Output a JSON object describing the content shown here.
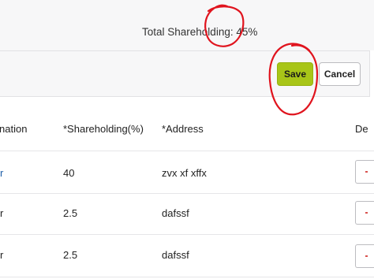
{
  "summary": {
    "total_text": "Total Shareholding: 45%"
  },
  "toolbar": {
    "save_label": "Save",
    "cancel_label": "Cancel"
  },
  "table": {
    "headers": [
      "nation",
      "*Shareholding(%)",
      "*Address",
      "De"
    ],
    "rows": [
      {
        "name": "r",
        "shareholding": "40",
        "address": "zvx xf xffx"
      },
      {
        "name": "r",
        "shareholding": "2.5",
        "address": "dafssf"
      },
      {
        "name": "r",
        "shareholding": "2.5",
        "address": "dafssf"
      }
    ]
  },
  "annotations": {
    "color": "#e0141e"
  },
  "colors": {
    "save_bg": "#a8c518",
    "link": "#1f5fa8",
    "delete_mark": "#d9534f"
  }
}
